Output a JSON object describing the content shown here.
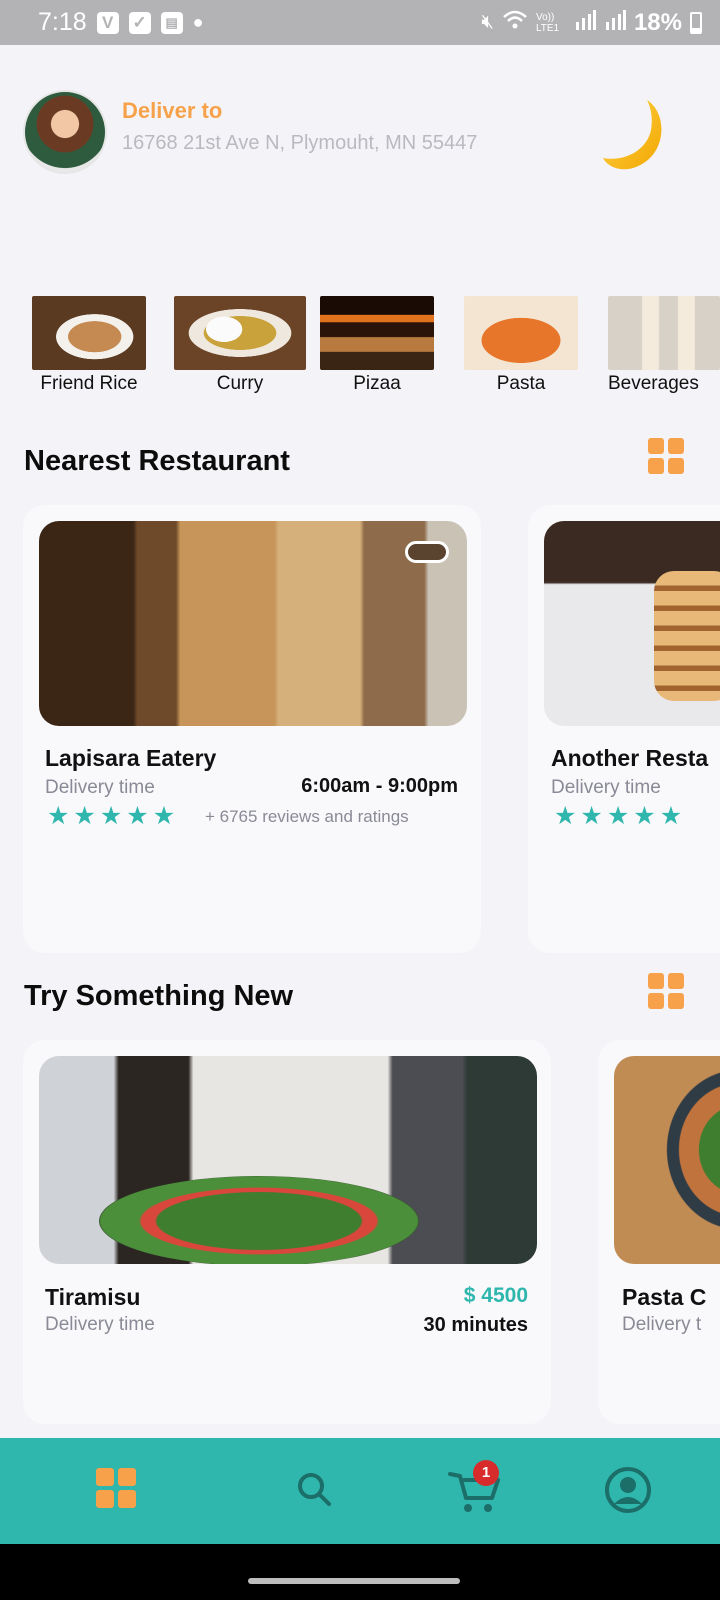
{
  "status_bar": {
    "time": "7:18",
    "battery": "18%",
    "network": "Vo)) LTE1"
  },
  "header": {
    "deliver_label": "Deliver to",
    "address": "16768 21st Ave N, Plymouht, MN 55447"
  },
  "categories": [
    {
      "label": "Friend Rice"
    },
    {
      "label": "Curry"
    },
    {
      "label": "Pizaa"
    },
    {
      "label": "Pasta"
    },
    {
      "label": "Beverages"
    }
  ],
  "nearest": {
    "title": "Nearest Restaurant",
    "cards": [
      {
        "name": "Lapisara Eatery",
        "delivery_label": "Delivery time",
        "hours": "6:00am - 9:00pm",
        "rating": 5,
        "reviews": "+ 6765 reviews and ratings"
      },
      {
        "name": "Another Resta",
        "delivery_label": "Delivery time",
        "rating": 5
      }
    ]
  },
  "try_new": {
    "title": "Try Something New",
    "cards": [
      {
        "name": "Tiramisu",
        "delivery_label": "Delivery time",
        "price": "$ 4500",
        "duration": "30 minutes"
      },
      {
        "name": "Pasta C",
        "delivery_label": "Delivery t"
      }
    ]
  },
  "nav": {
    "cart_count": "1",
    "accent": "#2fb6ad",
    "highlight": "#f7a24a"
  }
}
